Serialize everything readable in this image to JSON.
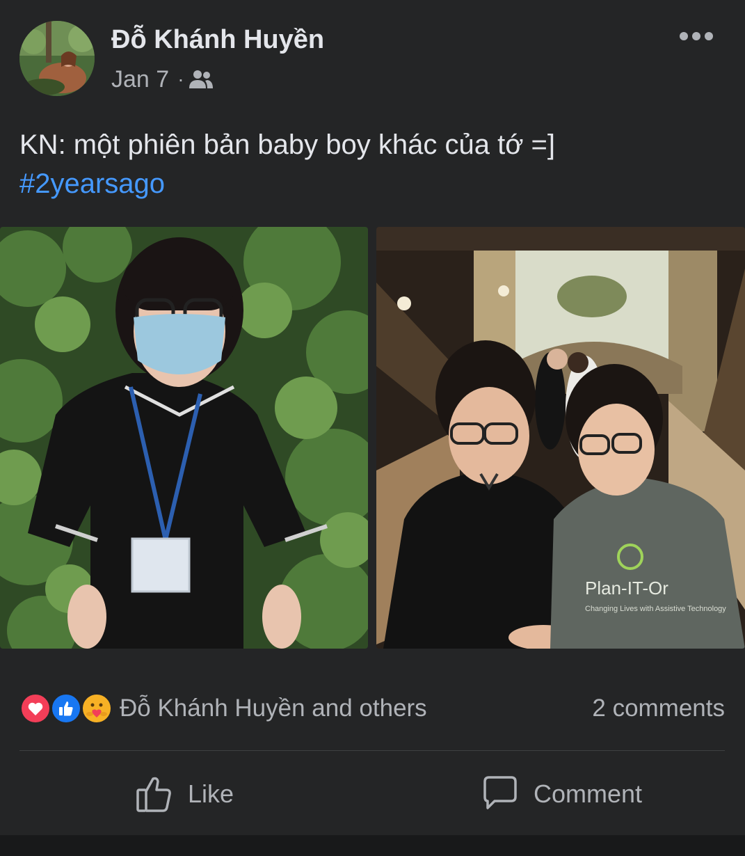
{
  "post": {
    "author": "Đỗ Khánh Huyền",
    "date": "Jan 7",
    "separator": "·",
    "audience_icon": "friends-icon",
    "text": "KN: một phiên bản baby boy khác của tớ =]",
    "hashtag": "#2yearsago"
  },
  "photos": [
    {
      "icon": "photo-person-masked"
    },
    {
      "icon": "photo-two-people-staircase",
      "shirt_text": "Plan-IT-Or",
      "shirt_subtext": "Changing Lives with Assistive Technology"
    }
  ],
  "reactions": {
    "icons": [
      "love-icon",
      "like-icon",
      "care-icon"
    ],
    "text": "Đỗ Khánh Huyền and others",
    "comments": "2 comments"
  },
  "actions": {
    "like_label": "Like",
    "comment_label": "Comment"
  },
  "colors": {
    "background": "#242526",
    "text": "#e4e6eb",
    "secondary_text": "#b0b3b8",
    "link": "#4599ff",
    "love": "#f33e58",
    "like": "#1877f2",
    "care": "#f7b125"
  }
}
